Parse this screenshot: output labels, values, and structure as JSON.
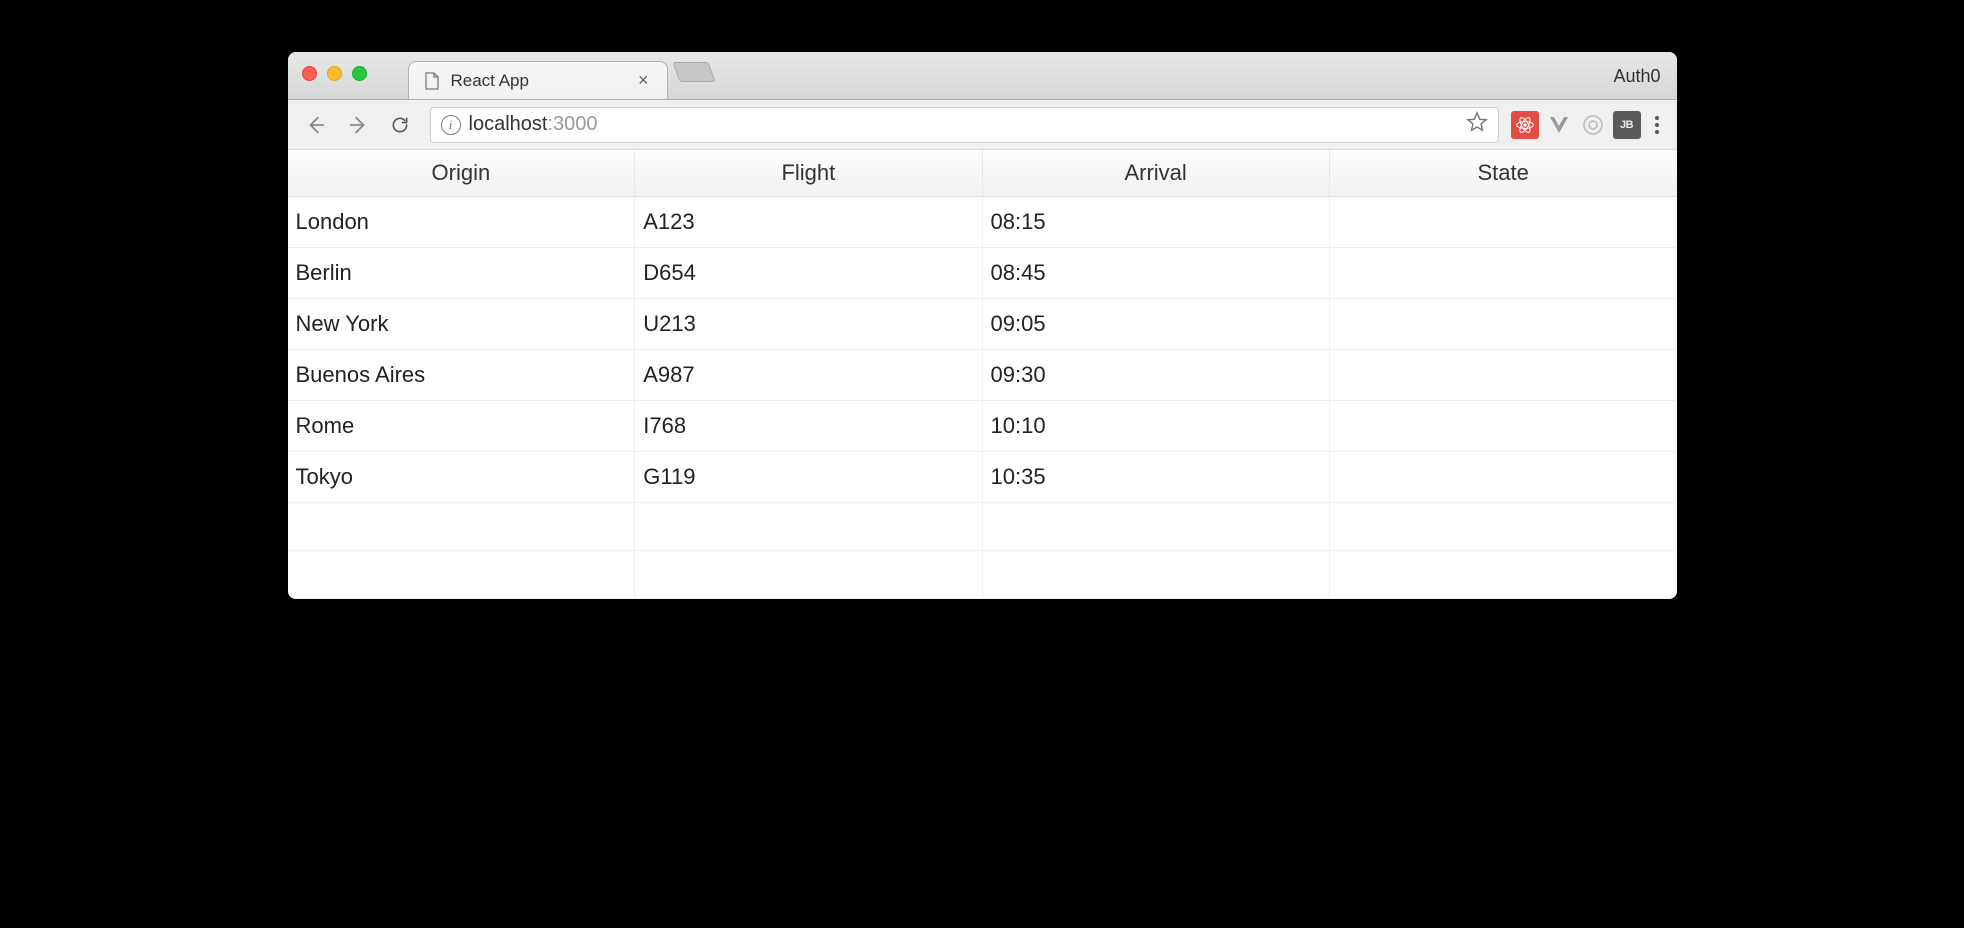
{
  "window": {
    "profile_label": "Auth0"
  },
  "tab": {
    "title": "React App"
  },
  "address": {
    "host": "localhost",
    "port": ":3000"
  },
  "table": {
    "headers": {
      "origin": "Origin",
      "flight": "Flight",
      "arrival": "Arrival",
      "state": "State"
    },
    "rows": [
      {
        "origin": "London",
        "flight": "A123",
        "arrival": "08:15",
        "state": ""
      },
      {
        "origin": "Berlin",
        "flight": "D654",
        "arrival": "08:45",
        "state": ""
      },
      {
        "origin": "New York",
        "flight": "U213",
        "arrival": "09:05",
        "state": ""
      },
      {
        "origin": "Buenos Aires",
        "flight": "A987",
        "arrival": "09:30",
        "state": ""
      },
      {
        "origin": "Rome",
        "flight": "I768",
        "arrival": "10:10",
        "state": ""
      },
      {
        "origin": "Tokyo",
        "flight": "G119",
        "arrival": "10:35",
        "state": ""
      }
    ],
    "empty_rows": 2
  },
  "extensions": {
    "jb_label": "JB"
  }
}
